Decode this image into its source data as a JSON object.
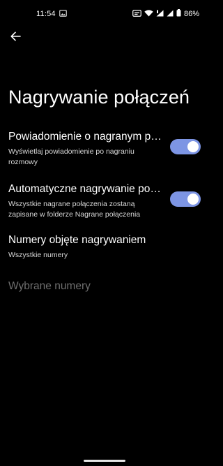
{
  "status_bar": {
    "time": "11:54",
    "battery": "86%"
  },
  "header": {
    "title": "Nagrywanie połączeń"
  },
  "settings": [
    {
      "title": "Powiadomienie o nagranym poł..",
      "summary": "Wyświetlaj powiadomienie po nagraniu rozmowy",
      "toggle_on": true
    },
    {
      "title": "Automatyczne nagrywanie połą..",
      "summary": "Wszystkie nagrane połączenia zostaną zapisane w folderze Nagrane połączenia",
      "toggle_on": true
    },
    {
      "title": "Numery objęte nagrywaniem",
      "summary": "Wszystkie numery"
    },
    {
      "title": "Wybrane numery",
      "disabled": true
    }
  ],
  "colors": {
    "background": "#000000",
    "toggle_track": "#7d95e4",
    "toggle_knob": "#ffffff",
    "disabled_text": "#6f6f6f"
  }
}
